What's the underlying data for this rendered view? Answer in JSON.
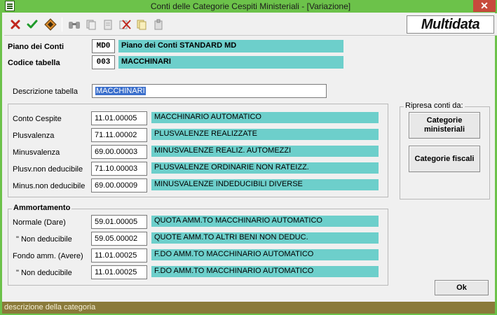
{
  "window": {
    "title": "Conti delle Categorie Cespiti Ministeriali - [Variazione]",
    "close_glyph": "✕",
    "brand": "Multidata"
  },
  "toolbar": {
    "icons": [
      "cancel-icon",
      "confirm-icon",
      "edit-icon",
      "binoculars-icon",
      "copy-icon",
      "paste-icon",
      "delete-icon",
      "duplicate-icon",
      "clipboard-icon"
    ]
  },
  "header": {
    "piano_label": "Piano dei Conti",
    "piano_code": "MD0",
    "piano_desc": "Piano dei Conti STANDARD MD",
    "codice_label": "Codice tabella",
    "codice_code": "003",
    "codice_desc": "MACCHINARI"
  },
  "descrizione": {
    "label": "Descrizione tabella",
    "value": "MACCHINARI"
  },
  "accounts": {
    "rows": [
      {
        "label": "Conto Cespite",
        "code": "11.01.00005",
        "desc": "MACCHINARIO AUTOMATICO"
      },
      {
        "label": "Plusvalenza",
        "code": "71.11.00002",
        "desc": "PLUSVALENZE REALIZZATE"
      },
      {
        "label": "Minusvalenza",
        "code": "69.00.00003",
        "desc": "MINUSVALENZE REALIZ. AUTOMEZZI"
      },
      {
        "label": "Plusv.non deducibile",
        "code": "71.10.00003",
        "desc": "PLUSVALENZE ORDINARIE NON RATEIZZ."
      },
      {
        "label": "Minus.non deducibile",
        "code": "69.00.00009",
        "desc": "MINUSVALENZE INDEDUCIBILI DIVERSE"
      }
    ]
  },
  "ammortamento": {
    "title": "Ammortamento",
    "rows": [
      {
        "label": "Normale  (Dare)",
        "code": "59.01.00005",
        "desc": "QUOTA AMM.TO MACCHINARIO AUTOMATICO"
      },
      {
        "label": "\"  Non deducibile",
        "code": "59.05.00002",
        "desc": "QUOTE AMM.TO ALTRI BENI NON DEDUC."
      },
      {
        "label": "Fondo amm. (Avere)",
        "code": "11.01.00025",
        "desc": "F.DO AMM.TO MACCHINARIO AUTOMATICO"
      },
      {
        "label": "\"  Non deducibile",
        "code": "11.01.00025",
        "desc": "F.DO AMM.TO MACCHINARIO AUTOMATICO"
      }
    ]
  },
  "ripresa": {
    "title": "Ripresa conti da:",
    "btn_ministeriali": "Categorie ministeriali",
    "btn_fiscali": "Categorie fiscali"
  },
  "ok_label": "Ok",
  "status": "descrizione della categoria"
}
